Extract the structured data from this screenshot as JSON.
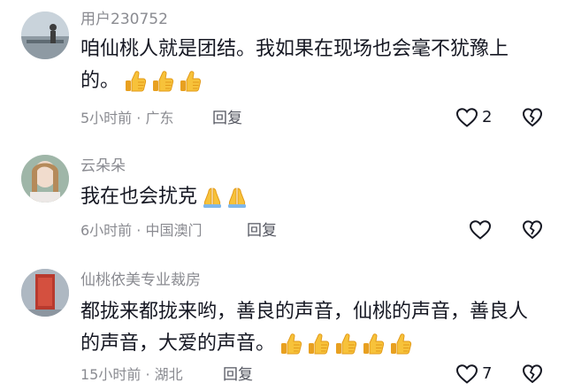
{
  "comments": [
    {
      "username": "用户230752",
      "text_line1": "咱仙桃人就是团结。我如果在现场也会毫不犹豫上",
      "text_line2": "的。",
      "emoji_icon": "thumbs-up",
      "emoji_count": 3,
      "time": "5小时前",
      "location": "广东",
      "reply_label": "回复",
      "likes": "2"
    },
    {
      "username": "云朵朵",
      "text_line1": "我在也会扰克",
      "emoji_icon": "folded-hands",
      "emoji_count": 2,
      "time": "6小时前",
      "location": "中国澳门",
      "reply_label": "回复",
      "likes": ""
    },
    {
      "username": "仙桃依美专业裁房",
      "text_line1": "都拢来都拢来哟，善良的声音，仙桃的声音，善良人",
      "text_line2": "的声音，大爱的声音。",
      "emoji_icon": "thumbs-up",
      "emoji_count": 5,
      "time": "15小时前",
      "location": "湖北",
      "reply_label": "回复",
      "likes": "7"
    }
  ],
  "meta_separator": " · ",
  "colors": {
    "muted_text": "#8a8b91",
    "body_text": "#161823",
    "emoji_yellow": "#f7b733",
    "emoji_outline": "#e39b1b"
  }
}
